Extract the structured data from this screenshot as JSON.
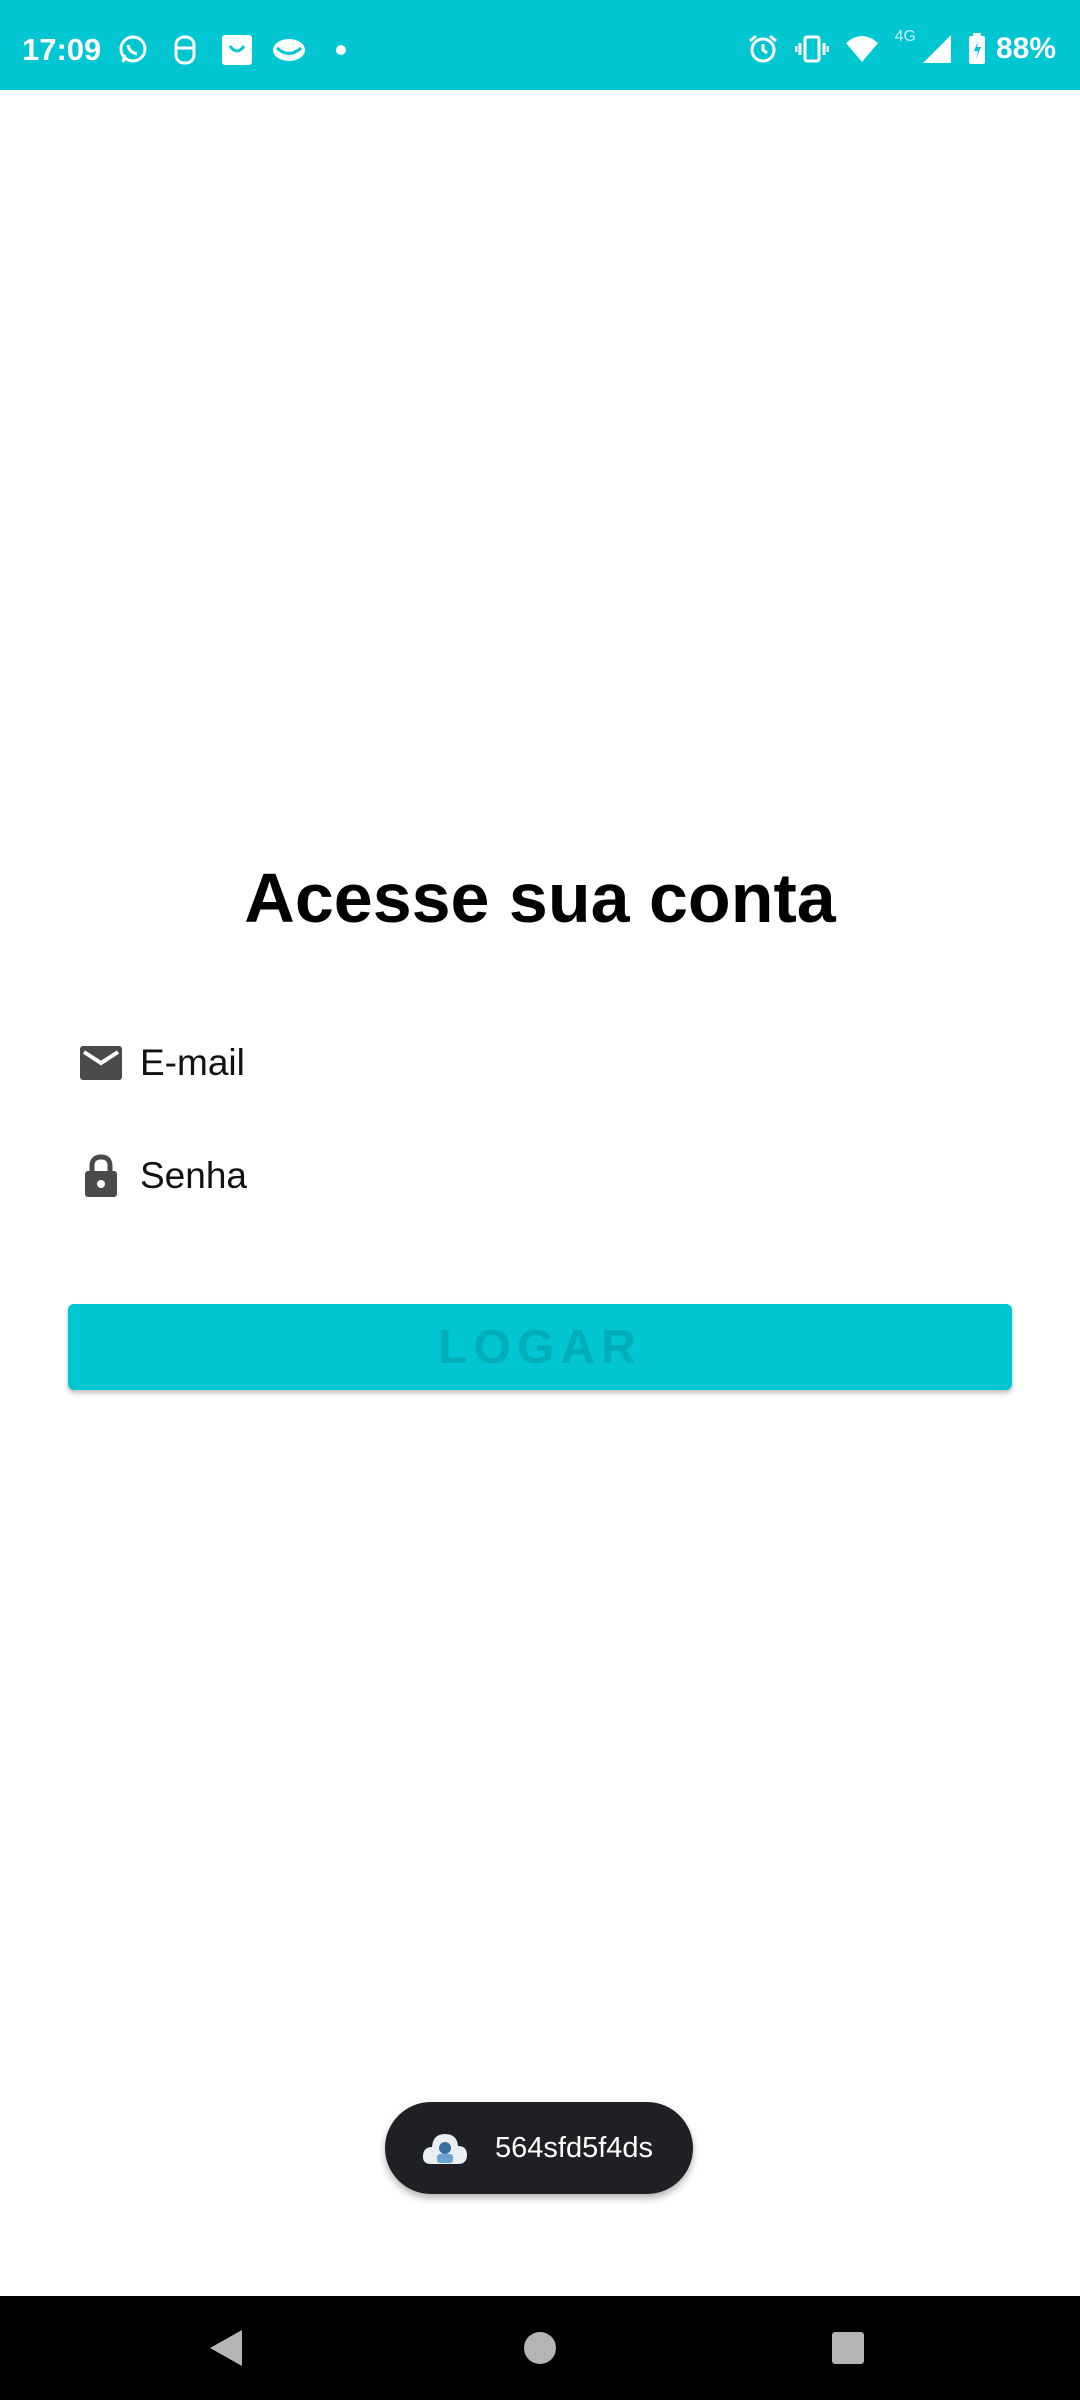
{
  "status_bar": {
    "time": "17:09",
    "network": "4G",
    "battery": "88%",
    "notification_icons": [
      "whatsapp-icon",
      "app-icon",
      "shopping-bag-icon",
      "app-eye-icon",
      "dot-icon"
    ],
    "system_icons": [
      "alarm-icon",
      "vibrate-icon",
      "wifi-icon",
      "signal-icon",
      "battery-icon"
    ],
    "color": "#00c6d2"
  },
  "login": {
    "title": "Acesse sua conta",
    "email_placeholder": "E-mail",
    "password_placeholder": "Senha",
    "button_label": "LOGAR",
    "accent_color": "#00c6d2"
  },
  "toast": {
    "text": "564sfd5f4ds",
    "icon": "cloud-app-icon"
  },
  "nav_bar": {
    "icons": [
      "back-icon",
      "home-icon",
      "recents-icon"
    ]
  }
}
